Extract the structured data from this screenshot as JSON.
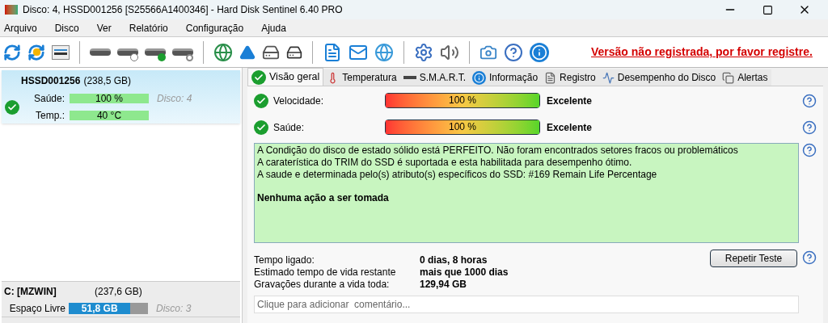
{
  "window": {
    "title": "Disco: 4, HSSD001256 [S25566A1400346]  -  Hard Disk Sentinel 6.40 PRO"
  },
  "menu": [
    "Arquivo",
    "Disco",
    "Ver",
    "Relatório",
    "Configuração",
    "Ajuda"
  ],
  "register_link": "Versão não registrada, por favor registre.",
  "disk_card": {
    "name": "HSSD001256",
    "size": "(238,5 GB)",
    "selected": true,
    "disk_label": "Disco: 4",
    "metrics": [
      {
        "label": "Saúde:",
        "value": "100 %",
        "level": 1
      },
      {
        "label": "Temp.:",
        "value": "40 °C",
        "level": 1
      }
    ]
  },
  "partition_card": {
    "name": "C: [MZWIN]",
    "size": "(237,6 GB)",
    "label": "Espaço Livre",
    "value": "51,8 GB",
    "level": 0.78,
    "disk_label": "Disco: 3"
  },
  "tabs": [
    {
      "label": "Visão geral",
      "selected": true
    },
    {
      "label": "Temperatura",
      "selected": false
    },
    {
      "label": "S.M.A.R.T.",
      "selected": false
    },
    {
      "label": "Informação",
      "selected": false
    },
    {
      "label": "Registro",
      "selected": false
    },
    {
      "label": "Desempenho do Disco",
      "selected": false
    },
    {
      "label": "Alertas",
      "selected": false
    }
  ],
  "gauges": [
    {
      "label": "Velocidade:",
      "value": "100 %",
      "level": 1,
      "rating": "Excelente"
    },
    {
      "label": "Saúde:",
      "value": "100 %",
      "level": 1,
      "rating": "Excelente"
    }
  ],
  "status_text": [
    "A Condição do disco de estado sólido está PERFEITO. Não foram encontrados setores fracos ou problemáticos",
    "A caraterística do TRIM do SSD é suportada e esta habilitada para desempenho ótimo.",
    "A saude e determinada pelo(s) atributo(s) específicos do SSD: #169 Remain Life Percentage"
  ],
  "status_action": "Nenhuma ação a ser tomada",
  "stats": [
    {
      "label": "Tempo ligado:",
      "value": "0 dias, 8 horas"
    },
    {
      "label": "Estimado tempo de vida restante",
      "value": "mais que 1000 dias"
    },
    {
      "label": "Gravações durante a vida toda:",
      "value": "129,94 GB"
    }
  ],
  "retest_button": "Repetir Teste",
  "comment": {
    "placeholder": "Clique para adicionar  comentário..."
  }
}
